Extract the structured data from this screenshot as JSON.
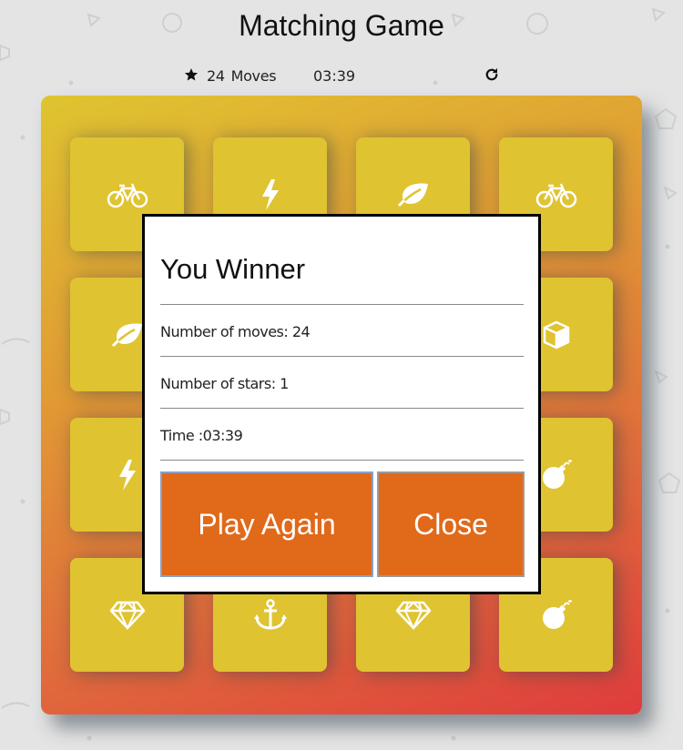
{
  "header": {
    "title": "Matching Game"
  },
  "score_panel": {
    "star_icon": "star-icon",
    "moves_count": "24",
    "moves_label": "Moves",
    "timer": "03:39",
    "restart_icon": "repeat-icon"
  },
  "deck": {
    "cards": [
      {
        "icon": "bicycle-icon"
      },
      {
        "icon": "bolt-icon"
      },
      {
        "icon": "leaf-icon"
      },
      {
        "icon": "bicycle-icon"
      },
      {
        "icon": "leaf-icon"
      },
      {
        "icon": "hidden"
      },
      {
        "icon": "hidden"
      },
      {
        "icon": "cube-icon"
      },
      {
        "icon": "bolt-icon"
      },
      {
        "icon": "hidden"
      },
      {
        "icon": "hidden"
      },
      {
        "icon": "bomb-icon"
      },
      {
        "icon": "diamond-icon"
      },
      {
        "icon": "anchor-icon"
      },
      {
        "icon": "diamond-icon"
      },
      {
        "icon": "bomb-icon"
      }
    ]
  },
  "modal": {
    "title": "You Winner",
    "moves_text": "Number of moves: 24",
    "stars_text": "Number of stars: 1",
    "time_text": "Time :03:39",
    "play_again_label": "Play Again",
    "close_label": "Close"
  },
  "colors": {
    "background": "#e4e4e4",
    "card": "#dfc331",
    "deck_gradient_start": "#dfc430",
    "deck_gradient_end": "#df3c3c",
    "button": "#e0691a"
  }
}
